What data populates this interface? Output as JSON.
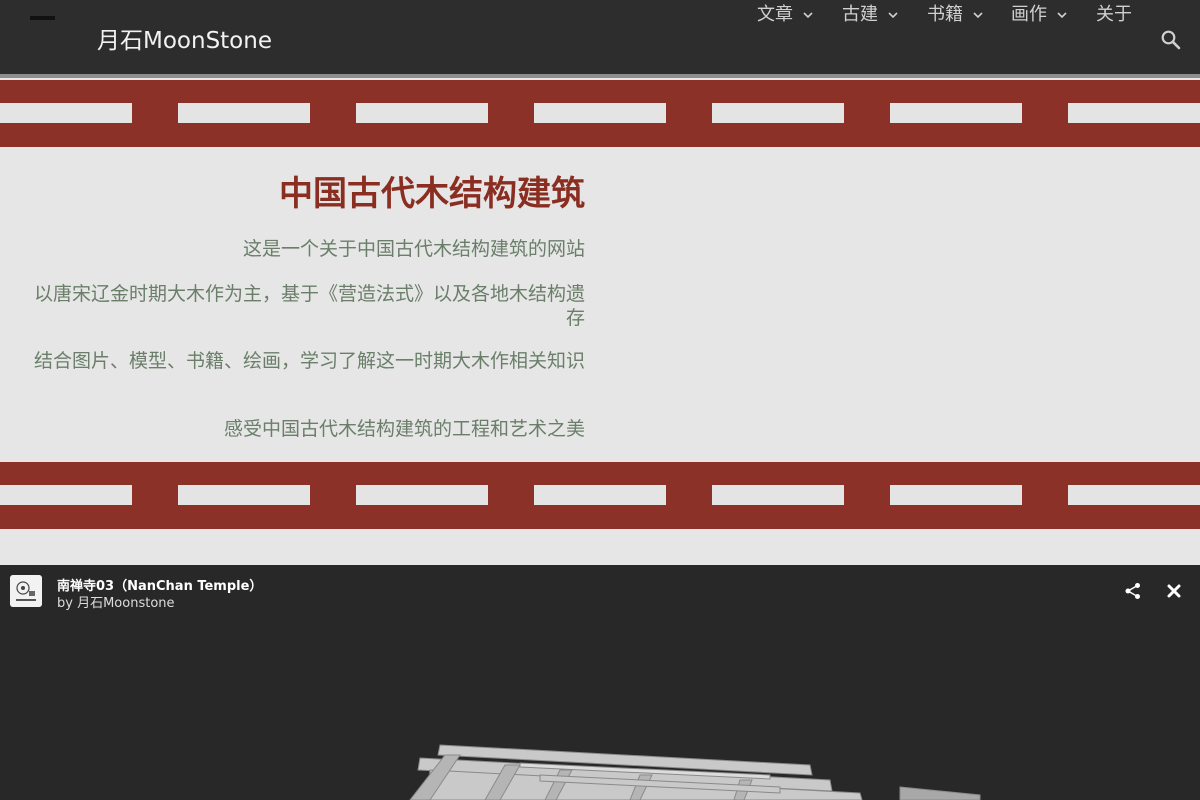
{
  "header": {
    "site_title": "月石MoonStone",
    "nav": [
      {
        "label": "文章",
        "has_dropdown": true
      },
      {
        "label": "古建",
        "has_dropdown": true
      },
      {
        "label": "书籍",
        "has_dropdown": true
      },
      {
        "label": "画作",
        "has_dropdown": true
      },
      {
        "label": "关于",
        "has_dropdown": false
      }
    ],
    "icons": {
      "search": "search-icon",
      "chevron": "chevron-down-icon",
      "menu": "menu-icon"
    }
  },
  "intro": {
    "title": "中国古代木结构建筑",
    "lines": [
      "这是一个关于中国古代木结构建筑的网站",
      "以唐宋辽金时期大木作为主，基于《营造法式》以及各地木结构遗存",
      "结合图片、模型、书籍、绘画，学习了解这一时期大木作相关知识",
      "感受中国古代木结构建筑的工程和艺术之美"
    ]
  },
  "viewer": {
    "title": "南禅寺03（NanChan Temple）",
    "author_prefix": "by",
    "author": "月石Moonstone",
    "avatar_icon": "moonstone-logo-icon",
    "actions": {
      "share": "share-icon",
      "close": "close-icon"
    }
  },
  "colors": {
    "header_bg": "#2d2d2d",
    "band_red": "#8b3128",
    "title_red": "#8b2e22",
    "body_text_green": "#6a7e6a",
    "page_bg": "#e6e6e6",
    "viewer_bg": "#282828"
  }
}
